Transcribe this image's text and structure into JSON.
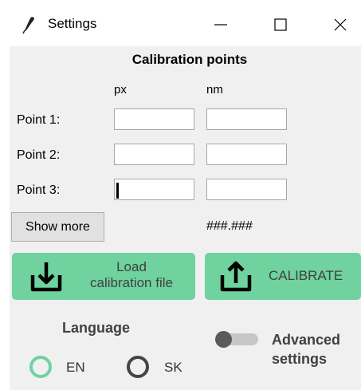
{
  "window": {
    "title": "Settings",
    "icon": "feather-icon",
    "controls": [
      "minimize-icon",
      "maximize-icon",
      "close-icon"
    ]
  },
  "calibration": {
    "heading": "Calibration points",
    "col_px": "px",
    "col_nm": "nm",
    "rows": [
      {
        "label": "Point  1:",
        "px": "",
        "nm": ""
      },
      {
        "label": "Point  2:",
        "px": "",
        "nm": ""
      },
      {
        "label": "Point  3:",
        "px": "",
        "nm": ""
      }
    ],
    "result": "###.###"
  },
  "buttons": {
    "show_more": "Show more",
    "load_line1": "Load",
    "load_line2": "calibration file",
    "load_icon": "download-icon",
    "calibrate": "CALIBRATE",
    "calibrate_icon": "upload-icon"
  },
  "language": {
    "title": "Language",
    "options": [
      {
        "label": "EN",
        "selected": true
      },
      {
        "label": "SK",
        "selected": false
      }
    ]
  },
  "advanced": {
    "line1": "Advanced",
    "line2": "settings",
    "enabled": false
  },
  "colors": {
    "accent": "#6fd29f",
    "panel": "#f0f0f0",
    "toggle_knob": "#5a5a5a"
  }
}
